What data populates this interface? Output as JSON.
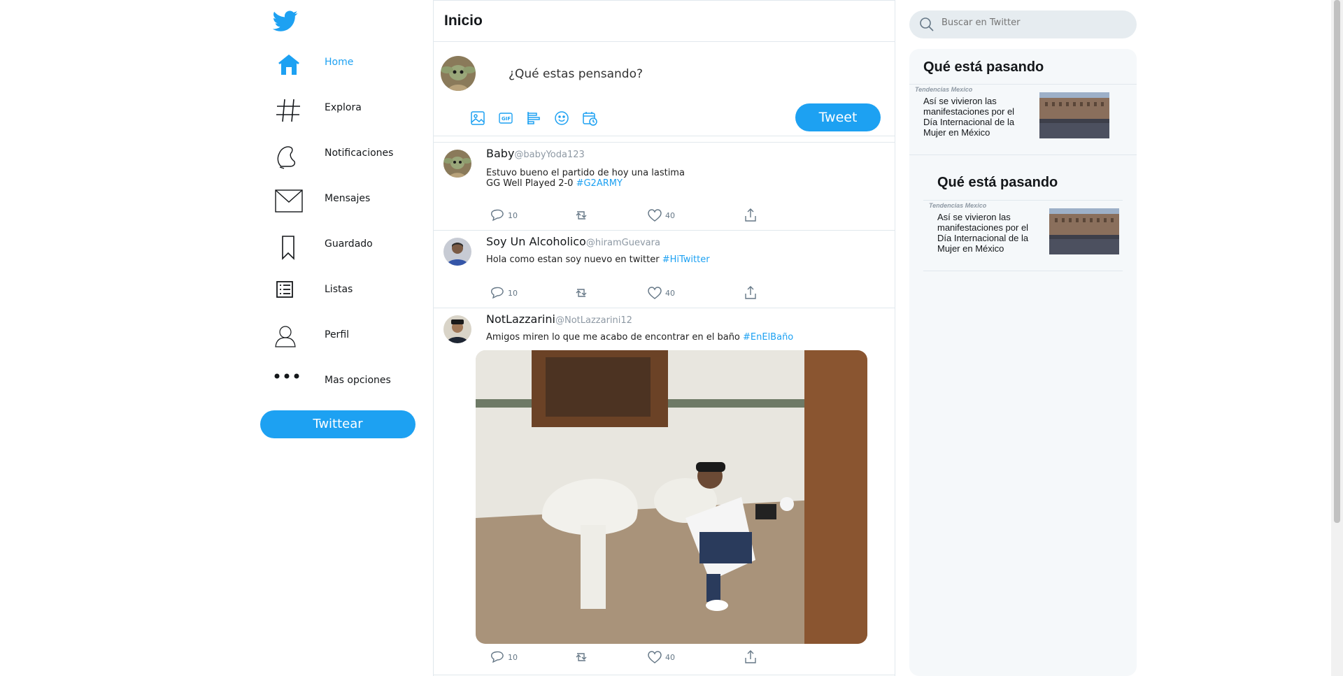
{
  "nav": {
    "items": [
      {
        "label": "Home",
        "icon": "home-icon",
        "active": true
      },
      {
        "label": "Explora",
        "icon": "hashtag-icon"
      },
      {
        "label": "Notificaciones",
        "icon": "bell-icon"
      },
      {
        "label": "Mensajes",
        "icon": "envelope-icon"
      },
      {
        "label": "Guardado",
        "icon": "bookmark-icon"
      },
      {
        "label": "Listas",
        "icon": "list-icon"
      },
      {
        "label": "Perfil",
        "icon": "user-icon"
      },
      {
        "label": "Mas opciones",
        "icon": "more-dots-icon"
      }
    ],
    "tweet_button": "Twittear"
  },
  "header": {
    "title": "Inicio"
  },
  "compose": {
    "placeholder": "¿Qué estas pensando?",
    "tools": [
      "image-icon",
      "gif-icon",
      "poll-icon",
      "emoji-icon",
      "schedule-icon"
    ],
    "send_label": "Tweet"
  },
  "tweets": [
    {
      "name": "Baby",
      "handle": "@babyYoda123",
      "text_line1": "Estuvo bueno el partido de hoy una lastima",
      "text_line2": "GG Well Played 2-0 ",
      "hashtag": "#G2ARMY",
      "replies": "10",
      "likes": "40"
    },
    {
      "name": "Soy Un Alcoholico",
      "handle": "@hiramGuevara",
      "text": "Hola como estan soy nuevo en twitter ",
      "hashtag": "#HiTwitter",
      "replies": "10",
      "likes": "40"
    },
    {
      "name": "NotLazzarini",
      "handle": "@NotLazzarini12",
      "text": "Amigos miren lo que me acabo de encontrar en el baño ",
      "hashtag": "#EnElBaño",
      "replies": "10",
      "likes": "40"
    }
  ],
  "search": {
    "placeholder": "Buscar en Twitter"
  },
  "trends": [
    {
      "heading": "Qué está pasando",
      "category": "Tendencias Mexico",
      "title": "Así se vivieron las manifestaciones por el Día Internacional de la Mujer en México"
    },
    {
      "heading": "Qué está pasando",
      "category": "Tendencias Mexico",
      "title": "Así se vivieron las manifestaciones por el Día Internacional de la Mujer en México"
    }
  ],
  "colors": {
    "accent": "#1da1f2",
    "border": "#e1e8ed",
    "panel": "#f5f8fa"
  }
}
